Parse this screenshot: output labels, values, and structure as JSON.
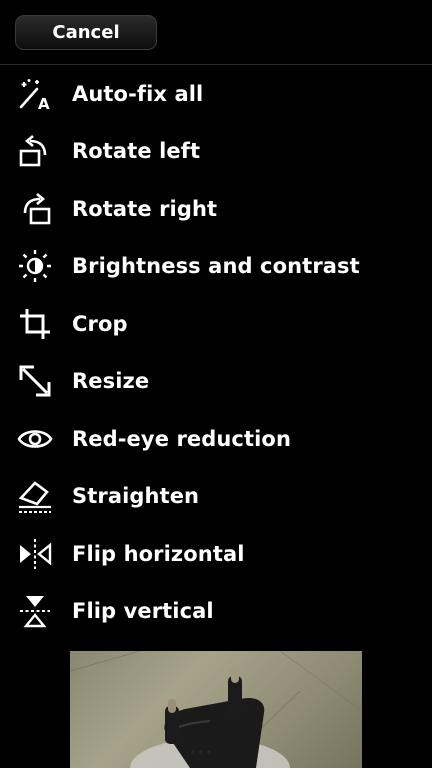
{
  "header": {
    "cancel_label": "Cancel"
  },
  "menu": {
    "items": [
      {
        "label": "Auto-fix all",
        "icon": "auto-fix-icon"
      },
      {
        "label": "Rotate left",
        "icon": "rotate-left-icon"
      },
      {
        "label": "Rotate right",
        "icon": "rotate-right-icon"
      },
      {
        "label": "Brightness and contrast",
        "icon": "brightness-icon"
      },
      {
        "label": "Crop",
        "icon": "crop-icon"
      },
      {
        "label": "Resize",
        "icon": "resize-icon"
      },
      {
        "label": "Red-eye reduction",
        "icon": "eye-icon"
      },
      {
        "label": "Straighten",
        "icon": "straighten-icon"
      },
      {
        "label": "Flip horizontal",
        "icon": "flip-horizontal-icon"
      },
      {
        "label": "Flip vertical",
        "icon": "flip-vertical-icon"
      }
    ]
  },
  "colors": {
    "background": "#000000",
    "text": "#ffffff",
    "divider": "#2c2c2c"
  }
}
